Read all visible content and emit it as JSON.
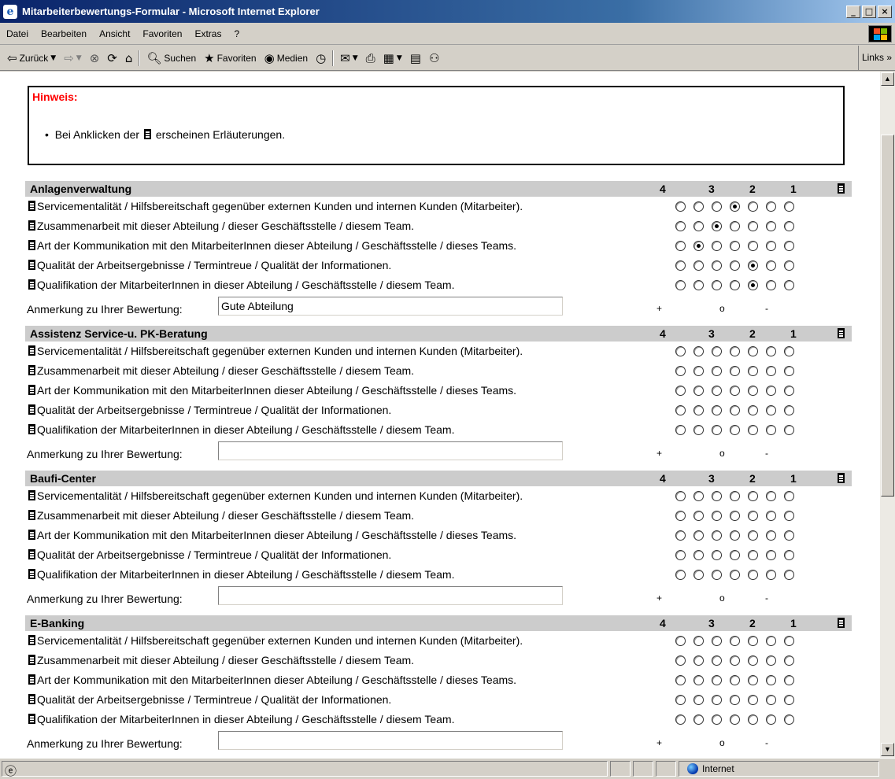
{
  "window": {
    "title": "Mitarbeiterbewertungs-Formular - Microsoft Internet Explorer",
    "min": "_",
    "max": "□",
    "close": "×"
  },
  "menu": [
    "Datei",
    "Bearbeiten",
    "Ansicht",
    "Favoriten",
    "Extras",
    "?"
  ],
  "toolbar": {
    "back": "Zurück",
    "search": "Suchen",
    "favorites": "Favoriten",
    "media": "Medien",
    "links": "Links »"
  },
  "hint": {
    "title": "Hinweis:",
    "item_before": "Bei Anklicken der",
    "item_after": "erscheinen Erläuterungen."
  },
  "columns": {
    "c4": "4",
    "c3": "3",
    "c2": "2",
    "c1": "1"
  },
  "scale": {
    "plus": "+",
    "zero": "o",
    "minus": "-"
  },
  "questions": [
    "Servicementalität / Hilfsbereitschaft gegenüber externen Kunden und internen Kunden (Mitarbeiter).",
    "Zusammenarbeit mit dieser Abteilung / dieser Geschäftsstelle / diesem Team.",
    "Art der Kommunikation mit den MitarbeiterInnen dieser Abteilung / Geschäftsstelle / dieses Teams.",
    "Qualität der Arbeitsergebnisse / Termintreue / Qualität der Informationen.",
    "Qualifikation der MitarbeiterInnen in dieser Abteilung / Geschäftsstelle / diesem Team."
  ],
  "comment_label": "Anmerkung zu Ihrer Bewertung:",
  "sections": [
    {
      "name": "Anlagenverwaltung",
      "selected": [
        3,
        2,
        1,
        4,
        4
      ],
      "comment": "Gute Abteilung"
    },
    {
      "name": "Assistenz Service-u. PK-Beratung",
      "selected": [
        null,
        null,
        null,
        null,
        null
      ],
      "comment": ""
    },
    {
      "name": "Baufi-Center",
      "selected": [
        null,
        null,
        null,
        null,
        null
      ],
      "comment": ""
    },
    {
      "name": "E-Banking",
      "selected": [
        null,
        null,
        null,
        null,
        null
      ],
      "comment": ""
    }
  ],
  "status": {
    "zone": "Internet"
  }
}
